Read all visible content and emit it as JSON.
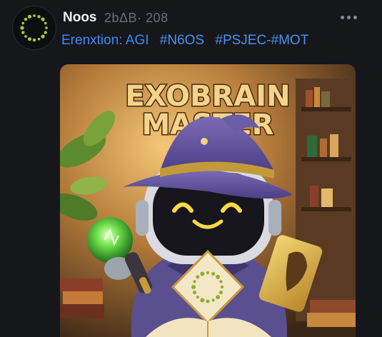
{
  "post": {
    "author_name": "Noos",
    "author_handle": "2bΔB· 208",
    "text_prefix": "Erenxtion: AGI",
    "hashtags": [
      "#N6OS",
      "#PSJEC",
      "-#MOT"
    ]
  },
  "media": {
    "title_line1": "EXOBRAIN",
    "title_line2": "MASTER"
  },
  "icons": {
    "avatar": "dotted-ring-logo",
    "more": "ellipsis-icon"
  },
  "colors": {
    "link": "#3c8cf0",
    "background": "#15171b",
    "logo_green": "#a6c93a",
    "title_gold": "#f3d48a"
  }
}
